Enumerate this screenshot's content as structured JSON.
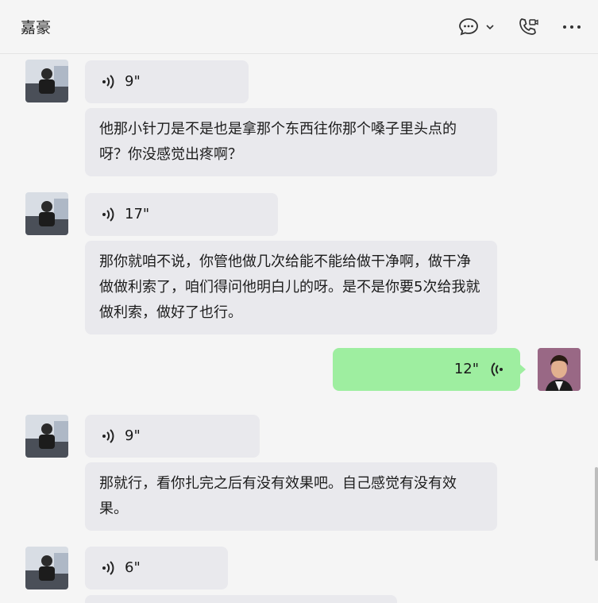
{
  "header": {
    "title": "嘉豪"
  },
  "messages": [
    {
      "duration": "9\"",
      "transcript": "他那小针刀是不是也是拿那个东西往你那个嗓子里头点的呀？你没感觉出疼啊？"
    },
    {
      "duration": "17\"",
      "transcript": "那你就咱不说，你管他做几次给能不能给做干净啊，做干净做做利索了，咱们得问他明白儿的呀。是不是你要5次给我就做利索，做好了也行。"
    },
    {
      "duration": "12\""
    },
    {
      "duration": "9\"",
      "transcript": "那就行，看你扎完之后有没有效果吧。自己感觉有没有效果。"
    },
    {
      "duration": "6\""
    }
  ],
  "colors": {
    "received_bubble": "#e9e9ed",
    "sent_bubble": "#9eeea0",
    "background": "#f5f5f5"
  }
}
